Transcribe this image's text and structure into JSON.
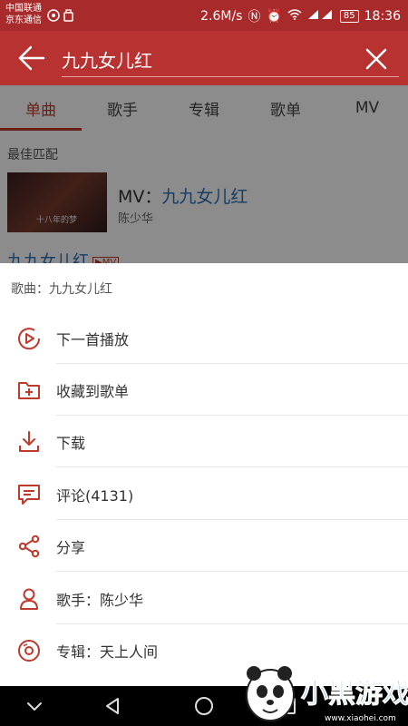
{
  "status_bar": {
    "carrier_1": "中国联通",
    "carrier_2": "京东通信",
    "speed": "2.6M/s",
    "battery": "85",
    "time": "18:36"
  },
  "search": {
    "value": "九九女儿红",
    "placeholder": ""
  },
  "tabs": [
    {
      "label": "单曲",
      "active": true
    },
    {
      "label": "歌手"
    },
    {
      "label": "专辑"
    },
    {
      "label": "歌单"
    },
    {
      "label": "MV"
    }
  ],
  "results": {
    "best_match_label": "最佳匹配",
    "mv_prefix": "MV：",
    "mv_title": "九九女儿红",
    "mv_artist": "陈少华",
    "thumb_caption": "十八年的梦",
    "song_title": "九九女儿红",
    "mv_badge": "▶MV"
  },
  "sheet": {
    "title": "歌曲：九九女儿红",
    "items": [
      {
        "label": "下一首播放",
        "icon": "play-next-icon"
      },
      {
        "label": "收藏到歌单",
        "icon": "add-to-folder-icon"
      },
      {
        "label": "下载",
        "icon": "download-icon"
      },
      {
        "label": "评论(4131)",
        "icon": "comment-icon"
      },
      {
        "label": "分享",
        "icon": "share-icon"
      },
      {
        "label": "歌手：陈少华",
        "icon": "artist-icon"
      },
      {
        "label": "专辑：天上人间",
        "icon": "album-icon"
      }
    ]
  },
  "watermark": {
    "brand": "小黑游戏",
    "url": "www.xiaohei.com"
  },
  "colors": {
    "accent": "#c0392b",
    "header": "#b83232",
    "link": "#2a6fb8"
  }
}
